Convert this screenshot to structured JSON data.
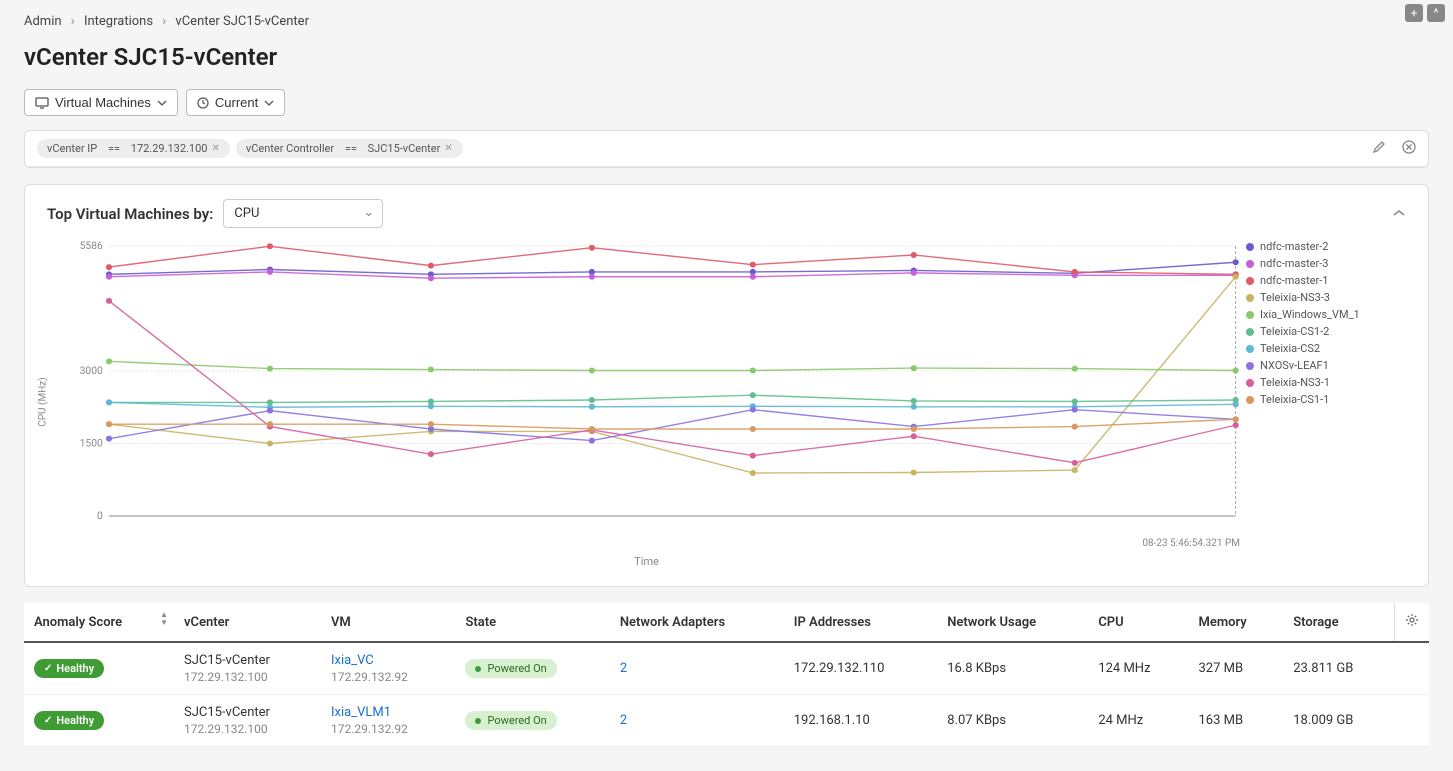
{
  "breadcrumb": {
    "admin": "Admin",
    "integrations": "Integrations",
    "current": "vCenter SJC15-vCenter"
  },
  "page_title": "vCenter SJC15-vCenter",
  "toolbar": {
    "vm_btn": "Virtual Machines",
    "current_btn": "Current"
  },
  "filters": {
    "chip1_key": "vCenter IP",
    "chip1_op": "==",
    "chip1_val": "172.29.132.100",
    "chip2_key": "vCenter Controller",
    "chip2_op": "==",
    "chip2_val": "SJC15-vCenter"
  },
  "chart": {
    "title_prefix": "Top Virtual Machines by:",
    "metric": "CPU",
    "ylabel": "CPU (MHz)",
    "xlabel": "Time",
    "timestamp": "08-23 5:46:54.321 PM",
    "yticks": [
      "5586",
      "3000",
      "1500",
      "0"
    ],
    "legend": [
      {
        "name": "ndfc-master-2",
        "color": "#6a5acd"
      },
      {
        "name": "ndfc-master-3",
        "color": "#c85fd6"
      },
      {
        "name": "ndfc-master-1",
        "color": "#e05a6b"
      },
      {
        "name": "Teleixia-NS3-3",
        "color": "#c8b464"
      },
      {
        "name": "Ixia_Windows_VM_1",
        "color": "#8cc86e"
      },
      {
        "name": "Teleixia-CS1-2",
        "color": "#5fbf8f"
      },
      {
        "name": "Teleixia-CS2",
        "color": "#5fb7d6"
      },
      {
        "name": "NXOSv-LEAF1",
        "color": "#8a73e0"
      },
      {
        "name": "Teleixia-NS3-1",
        "color": "#d65f9c"
      },
      {
        "name": "Teleixia-CS1-1",
        "color": "#d69a5f"
      }
    ]
  },
  "chart_data": {
    "type": "line",
    "xlabel": "Time",
    "ylabel": "CPU (MHz)",
    "ylim": [
      0,
      5586
    ],
    "x": [
      0,
      1,
      2,
      3,
      4,
      5,
      6,
      7
    ],
    "series": [
      {
        "name": "ndfc-master-2",
        "color": "#6a5acd",
        "values": [
          5000,
          5100,
          5000,
          5050,
          5050,
          5080,
          5020,
          5250
        ]
      },
      {
        "name": "ndfc-master-3",
        "color": "#c85fd6",
        "values": [
          4950,
          5050,
          4920,
          4950,
          4950,
          5030,
          4980,
          4980
        ]
      },
      {
        "name": "ndfc-master-1",
        "color": "#e05a6b",
        "values": [
          5150,
          5580,
          5180,
          5550,
          5200,
          5400,
          5050,
          5000
        ]
      },
      {
        "name": "Teleixia-NS3-3",
        "color": "#c8b464",
        "values": [
          1900,
          1500,
          1750,
          1750,
          890,
          900,
          950,
          4950
        ]
      },
      {
        "name": "Ixia_Windows_VM_1",
        "color": "#8cc86e",
        "values": [
          3200,
          3050,
          3030,
          3010,
          3010,
          3060,
          3050,
          3010
        ]
      },
      {
        "name": "Teleixia-CS1-2",
        "color": "#5fbf8f",
        "values": [
          2350,
          2350,
          2370,
          2400,
          2500,
          2380,
          2370,
          2400
        ]
      },
      {
        "name": "Teleixia-CS2",
        "color": "#5fb7d6",
        "values": [
          2350,
          2250,
          2270,
          2260,
          2270,
          2260,
          2260,
          2310
        ]
      },
      {
        "name": "NXOSv-LEAF1",
        "color": "#8a73e0",
        "values": [
          1600,
          2180,
          1800,
          1560,
          2200,
          1850,
          2200,
          2000
        ]
      },
      {
        "name": "Teleixia-NS3-1",
        "color": "#d65f9c",
        "values": [
          4450,
          1850,
          1280,
          1780,
          1250,
          1650,
          1100,
          1880
        ]
      },
      {
        "name": "Teleixia-CS1-1",
        "color": "#d69a5f",
        "values": [
          1900,
          1900,
          1900,
          1800,
          1800,
          1800,
          1850,
          2000
        ]
      }
    ]
  },
  "table": {
    "headers": {
      "anomaly": "Anomaly Score",
      "vcenter": "vCenter",
      "vm": "VM",
      "state": "State",
      "adapters": "Network Adapters",
      "ips": "IP Addresses",
      "netusage": "Network Usage",
      "cpu": "CPU",
      "memory": "Memory",
      "storage": "Storage"
    },
    "rows": [
      {
        "anomaly": "Healthy",
        "vcenter_name": "SJC15-vCenter",
        "vcenter_ip": "172.29.132.100",
        "vm_name": "Ixia_VC",
        "vm_ip": "172.29.132.92",
        "state": "Powered On",
        "adapters": "2",
        "ips": "172.29.132.110",
        "netusage": "16.8 KBps",
        "cpu": "124 MHz",
        "memory": "327 MB",
        "storage": "23.811 GB"
      },
      {
        "anomaly": "Healthy",
        "vcenter_name": "SJC15-vCenter",
        "vcenter_ip": "172.29.132.100",
        "vm_name": "Ixia_VLM1",
        "vm_ip": "172.29.132.92",
        "state": "Powered On",
        "adapters": "2",
        "ips": "192.168.1.10",
        "netusage": "8.07 KBps",
        "cpu": "24 MHz",
        "memory": "163 MB",
        "storage": "18.009 GB"
      }
    ]
  }
}
